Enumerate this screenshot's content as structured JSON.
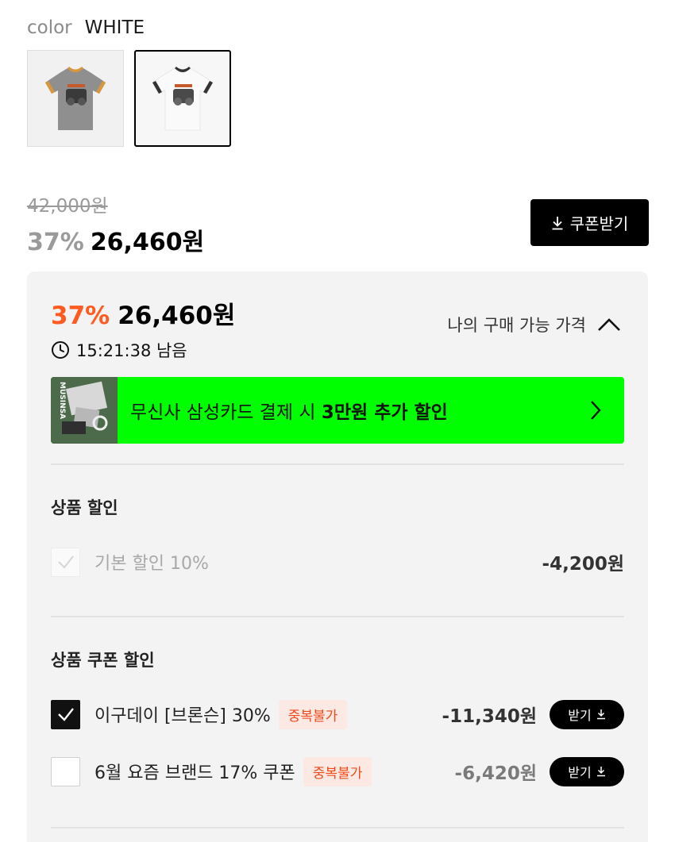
{
  "color": {
    "label": "color",
    "value": "WHITE"
  },
  "swatches": [
    {
      "name": "gray",
      "selected": false
    },
    {
      "name": "white",
      "selected": true
    }
  ],
  "pricing": {
    "original": "42,000원",
    "discount_pct": "37%",
    "price": "26,460원"
  },
  "coupon_button": {
    "label": "쿠폰받기"
  },
  "panel": {
    "discount_pct": "37%",
    "price": "26,460원",
    "timer": "15:21:38 남음",
    "my_price_toggle": "나의 구매 가능 가격",
    "banner": {
      "thumb_text": "MUSINSA",
      "text_prefix": "무신사 삼성카드 결제 시 ",
      "text_bold": "3만원 추가 할인"
    },
    "product_discount": {
      "title": "상품 할인",
      "items": [
        {
          "label": "기본 할인 10%",
          "amount": "-4,200원"
        }
      ]
    },
    "coupon_discount": {
      "title": "상품 쿠폰 할인",
      "items": [
        {
          "label": "이구데이 [브론슨] 30%",
          "badge": "중복불가",
          "amount": "-11,340원",
          "button": "받기",
          "checked": true
        },
        {
          "label": "6월 요즘 브랜드 17% 쿠폰",
          "badge": "중복불가",
          "amount": "-6,420원",
          "button": "받기",
          "checked": false
        }
      ]
    }
  },
  "colors": {
    "accent_orange": "#ff5a1f",
    "banner_green": "#00ff00",
    "badge_bg": "#fde9e3",
    "badge_text": "#f04a1a"
  }
}
